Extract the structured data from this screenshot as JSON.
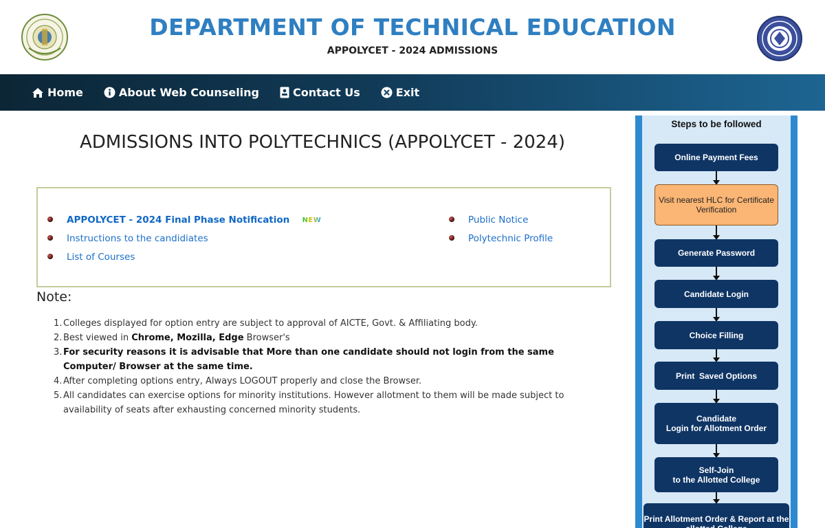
{
  "header": {
    "title": "DEPARTMENT OF TECHNICAL EDUCATION",
    "subtitle": "APPOLYCET - 2024 ADMISSIONS"
  },
  "nav": {
    "items": [
      {
        "label": "Home",
        "icon": "home-icon"
      },
      {
        "label": "About Web Counseling",
        "icon": "info-icon"
      },
      {
        "label": "Contact Us",
        "icon": "contact-card-icon"
      },
      {
        "label": "Exit",
        "icon": "close-circle-icon"
      }
    ]
  },
  "main": {
    "heading": "ADMISSIONS INTO POLYTECHNICS (APPOLYCET - 2024)",
    "links_left": [
      {
        "label": "APPOLYCET - 2024 Final Phase Notification",
        "badge": "NEW"
      },
      {
        "label": "Instructions to the candidiates"
      },
      {
        "label": "List of Courses"
      }
    ],
    "links_right": [
      {
        "label": "Public Notice"
      },
      {
        "label": "Polytechnic Profile"
      }
    ],
    "note_title": "Note:",
    "notes": [
      {
        "num": "1.",
        "text": "Colleges displayed for option entry are subject to approval of AICTE, Govt. & Affiliating body."
      },
      {
        "num": "2.",
        "pre": "Best viewed in ",
        "bold": "Chrome, Mozilla, Edge",
        "post": " Browser's"
      },
      {
        "num": "3.",
        "bold_full": "For security reasons it is advisable that More than one candidate should not login from the same Computer/ Browser at the same time."
      },
      {
        "num": "4.",
        "text": "After completing options entry, Always LOGOUT properly and close the Browser."
      },
      {
        "num": "5.",
        "text": "All candidates can exercise options for minority institutions. However allotment to them will be made subject to availability of seats after exhausting concerned minority students."
      }
    ]
  },
  "sidebar": {
    "title": "Steps to be followed",
    "steps": [
      {
        "label": "Online Payment Fees"
      },
      {
        "label": "Visit nearest HLC for Certificate Verification"
      },
      {
        "label": "Generate Password"
      },
      {
        "label": "Candidate Login"
      },
      {
        "label": "Choice Filling"
      },
      {
        "label": "Print  Saved Options"
      },
      {
        "label": "Candidate\nLogin for Allotment Order"
      },
      {
        "label": "Self-Join\nto the Allotted College"
      },
      {
        "label": "Print Allotment Order & Report at the allotted College"
      }
    ]
  },
  "colors": {
    "title_blue": "#2f7fc1",
    "nav_dark": "#0c2636",
    "nav_light": "#1d6592",
    "step_navy": "#0f3565",
    "step_orange": "#fbb574",
    "sidebar_bg": "#d7e9f7",
    "sidebar_border": "#2d8ad1",
    "link_blue": "#1c6fc9"
  }
}
